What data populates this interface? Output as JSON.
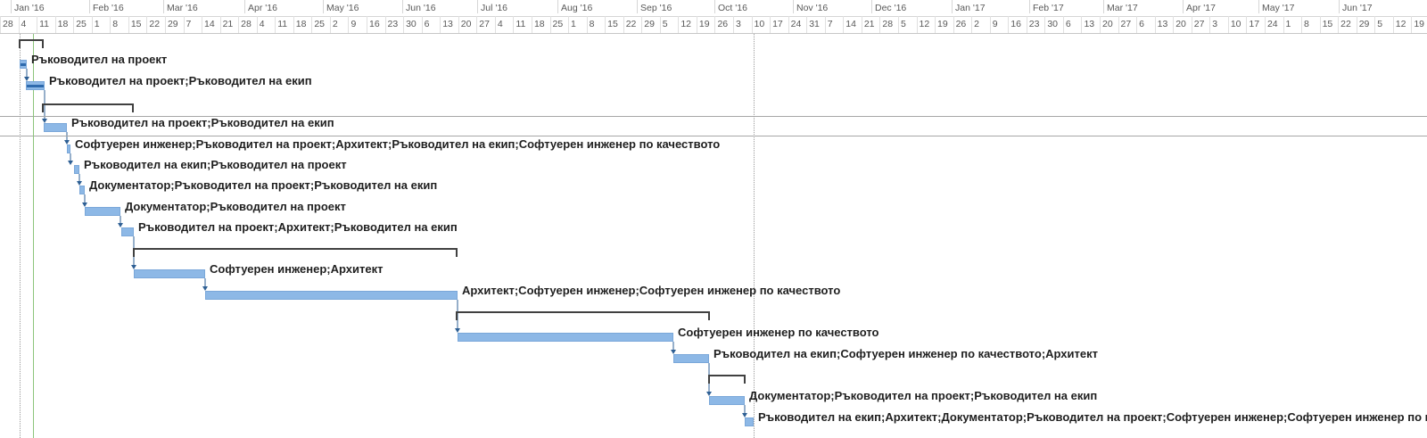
{
  "timescale": {
    "months": [
      "Jan '16",
      "Feb '16",
      "Mar '16",
      "Apr '16",
      "May '16",
      "Jun '16",
      "Jul '16",
      "Aug '16",
      "Sep '16",
      "Oct '16",
      "Nov '16",
      "Dec '16",
      "Jan '17",
      "Feb '17",
      "Mar '17",
      "Apr '17",
      "May '17",
      "Jun '17"
    ],
    "weeks": [
      "28",
      "4",
      "11",
      "18",
      "25",
      "1",
      "8",
      "15",
      "22",
      "29",
      "7",
      "14",
      "21",
      "28",
      "4",
      "11",
      "18",
      "25",
      "2",
      "9",
      "16",
      "23",
      "30",
      "6",
      "13",
      "20",
      "27",
      "4",
      "11",
      "18",
      "25",
      "1",
      "8",
      "15",
      "22",
      "29",
      "5",
      "12",
      "19",
      "26",
      "3",
      "10",
      "17",
      "24",
      "31",
      "7",
      "14",
      "21",
      "28",
      "5",
      "12",
      "19",
      "26",
      "2",
      "9",
      "16",
      "23",
      "30",
      "6",
      "13",
      "20",
      "27",
      "6",
      "13",
      "20",
      "27",
      "3",
      "10",
      "17",
      "24",
      "1",
      "8",
      "15",
      "22",
      "29",
      "5",
      "12",
      "19"
    ]
  },
  "tasks": [
    {
      "type": "summary",
      "label": ""
    },
    {
      "type": "task",
      "label": "Ръководител на проект",
      "progress": 1.0
    },
    {
      "type": "task",
      "label": "Ръководител на проект;Ръководител на екип",
      "progress": 1.0
    },
    {
      "type": "summary",
      "label": ""
    },
    {
      "type": "task",
      "label": "Ръководител на проект;Ръководител на екип",
      "progress": 0
    },
    {
      "type": "task",
      "label": "Софтуерен инженер;Ръководител на проект;Архитект;Ръководител на екип;Софтуерен инженер по качеството",
      "progress": 0
    },
    {
      "type": "task",
      "label": "Ръководител на екип;Ръководител на проект",
      "progress": 0
    },
    {
      "type": "task",
      "label": "Документатор;Ръководител на проект;Ръководител на екип",
      "progress": 0
    },
    {
      "type": "task",
      "label": "Документатор;Ръководител на проект",
      "progress": 0
    },
    {
      "type": "task",
      "label": "Ръководител на проект;Архитект;Ръководител на екип",
      "progress": 0
    },
    {
      "type": "summary",
      "label": ""
    },
    {
      "type": "task",
      "label": "Софтуерен инженер;Архитект",
      "progress": 0
    },
    {
      "type": "task",
      "label": "Архитект;Софтуерен инженер;Софтуерен инженер по качеството",
      "progress": 0
    },
    {
      "type": "summary",
      "label": ""
    },
    {
      "type": "task",
      "label": "Софтуерен инженер по качеството",
      "progress": 0
    },
    {
      "type": "task",
      "label": "Ръководител на екип;Софтуерен инженер по качеството;Архитект",
      "progress": 0
    },
    {
      "type": "summary",
      "label": ""
    },
    {
      "type": "task",
      "label": "Документатор;Ръководител на проект;Ръководител на екип",
      "progress": 0
    },
    {
      "type": "task",
      "label": "Ръководител на екип;Архитект;Документатор;Ръководител на проект;Софтуерен инженер;Софтуерен инженер по качеството",
      "progress": 0
    }
  ],
  "colors": {
    "bar": "#8db8e6",
    "progress": "#2e6aad",
    "summary": "#404040",
    "today": "#8cc47a",
    "link": "#2e5f94"
  }
}
